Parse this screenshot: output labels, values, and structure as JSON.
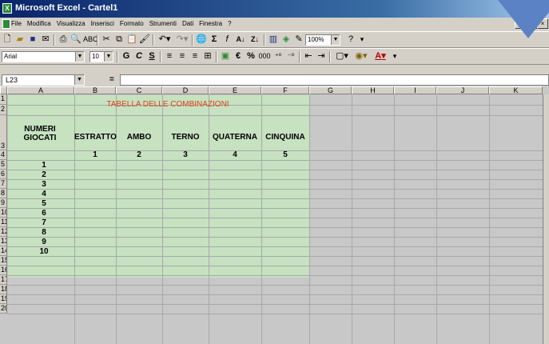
{
  "window": {
    "title": "Microsoft Excel - Cartel1",
    "app_icon": "excel-icon",
    "buttons": [
      "_",
      "□",
      "×"
    ]
  },
  "menu": {
    "items": [
      "File",
      "Modifica",
      "Visualizza",
      "Inserisci",
      "Formato",
      "Strumenti",
      "Dati",
      "Finestra",
      "?"
    ],
    "doc_buttons": [
      "_",
      "□",
      "×"
    ]
  },
  "standard_toolbar": {
    "icons": [
      "new-document-icon",
      "open-folder-icon",
      "save-icon",
      "print-icon",
      "print-preview-icon",
      "spelling-icon",
      "cut-icon",
      "copy-icon",
      "paste-icon",
      "format-painter-icon",
      "undo-icon",
      "redo-icon",
      "hyperlink-icon",
      "autosum-icon",
      "function-icon",
      "sort-ascending-icon",
      "sort-descending-icon",
      "chart-wizard-icon",
      "map-icon",
      "help-icon"
    ],
    "zoom": "100%",
    "sum_symbol": "Σ",
    "function_symbol": "f",
    "sort_az": "A↓",
    "sort_za": "Z↓"
  },
  "format_toolbar": {
    "font_name": "Arial",
    "font_size": "10",
    "bold": "G",
    "italic": "C",
    "underline": "S",
    "currency_symbol": "€",
    "percent_symbol": "%",
    "thousands_symbol": "000",
    "font_color_letter": "A"
  },
  "formula_bar": {
    "name_box": "L23",
    "equals": "=",
    "content": ""
  },
  "columns": [
    "A",
    "B",
    "C",
    "D",
    "E",
    "F",
    "G",
    "H",
    "I",
    "J",
    "K"
  ],
  "rows": [
    "1",
    "2",
    "3",
    "4",
    "5",
    "6",
    "7",
    "8",
    "9",
    "10",
    "11",
    "12",
    "13",
    "14",
    "15",
    "16",
    "17",
    "18",
    "19",
    "20"
  ],
  "sheet": {
    "title": "TABELLA DELLE COMBINAZIONI",
    "header_first": "NUMERI GIOCATI",
    "headers": [
      "ESTRATTO",
      "AMBO",
      "TERNO",
      "QUATERNA",
      "CINQUINA"
    ],
    "header_numbers": [
      "1",
      "2",
      "3",
      "4",
      "5"
    ],
    "numbers_played": [
      "1",
      "2",
      "3",
      "4",
      "5",
      "6",
      "7",
      "8",
      "9",
      "10"
    ]
  },
  "colors": {
    "table_fill": "#c6e2c0",
    "title_red": "#e0401a",
    "title_bar_blue": "#0a246a",
    "overlay_triangle": "#5b82c4"
  }
}
